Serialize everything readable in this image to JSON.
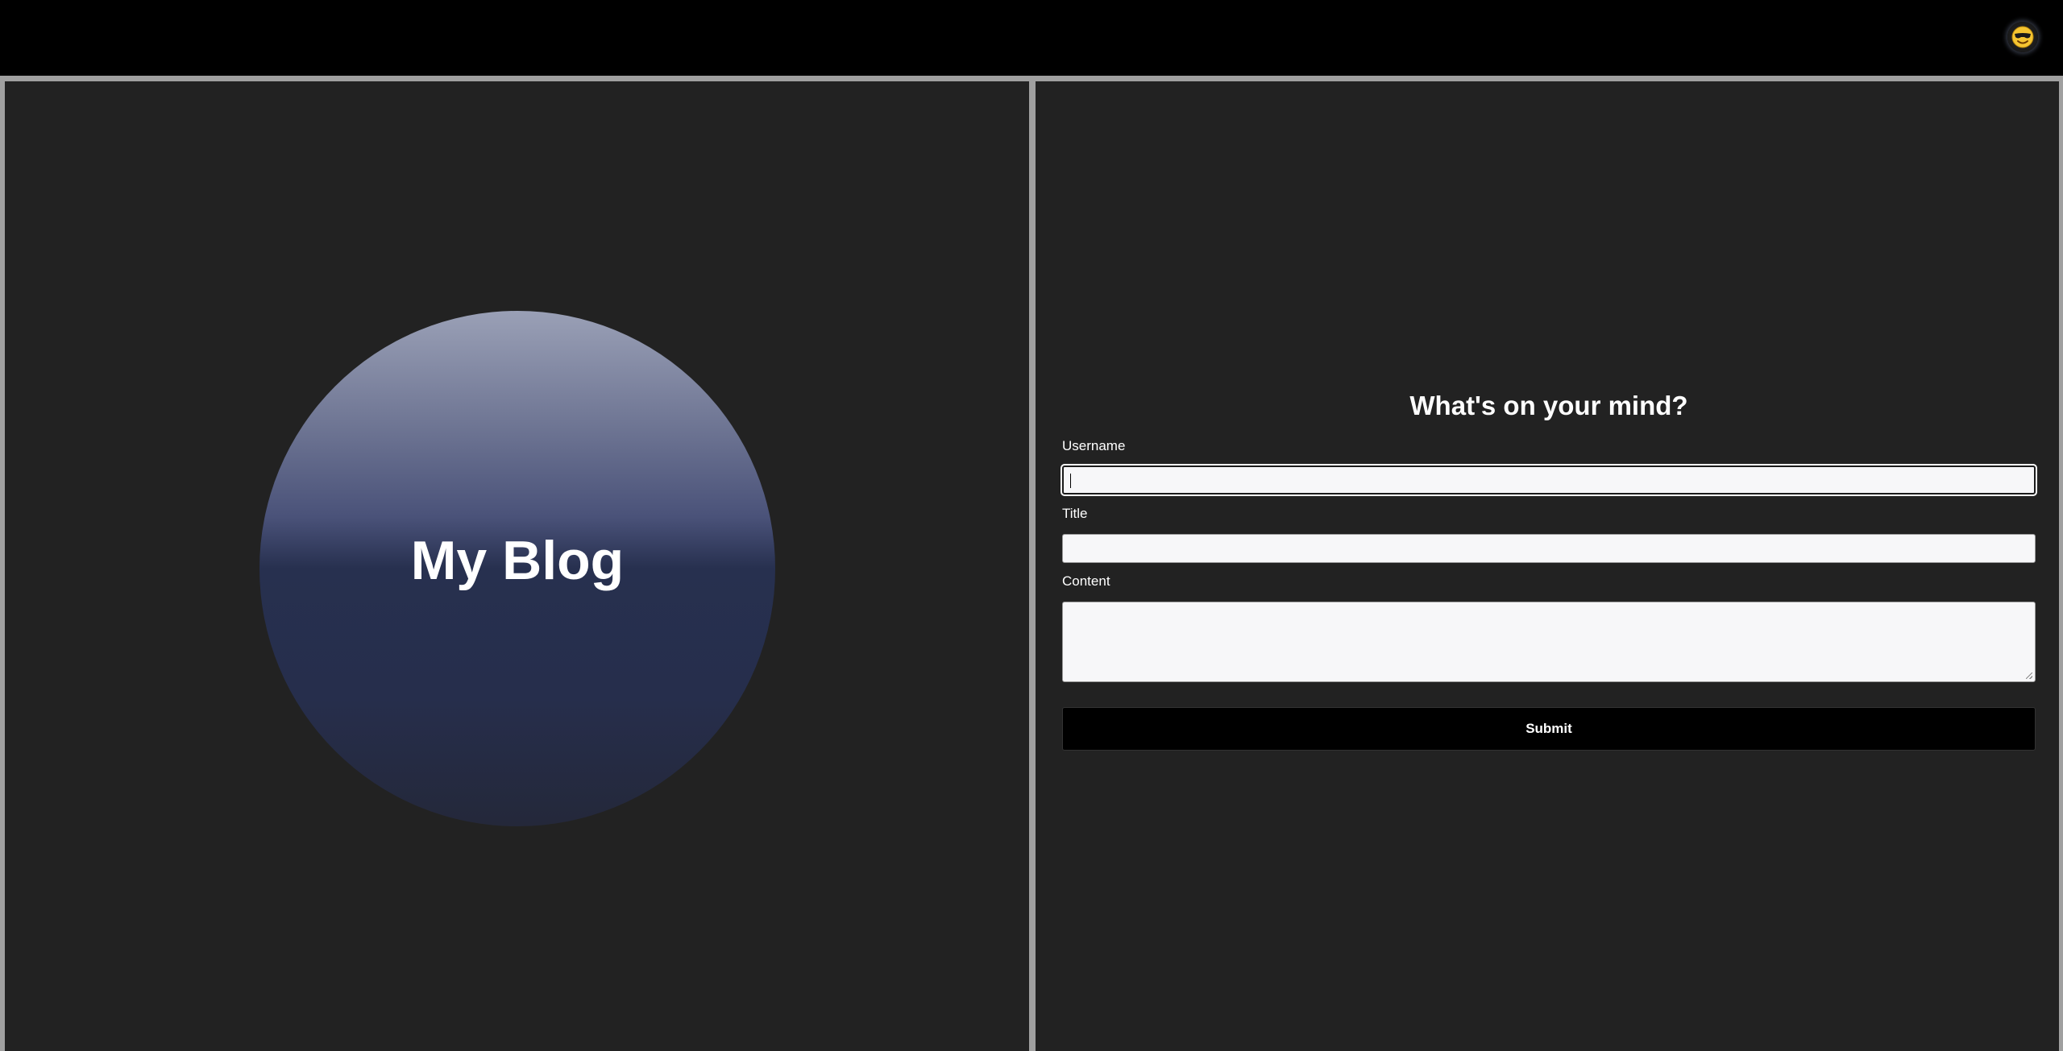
{
  "header": {
    "avatar_icon": "smiling-face-with-sunglasses-icon",
    "avatar_glyph": "😎"
  },
  "hero": {
    "title": "My Blog"
  },
  "form": {
    "heading": "What's on your mind?",
    "username_label": "Username",
    "username_value": "",
    "title_label": "Title",
    "title_value": "",
    "content_label": "Content",
    "content_value": "",
    "submit_label": "Submit"
  },
  "colors": {
    "background": "#222222",
    "topbar": "#000000",
    "divider": "#a0a0a0",
    "button": "#000000",
    "text": "#ffffff"
  }
}
